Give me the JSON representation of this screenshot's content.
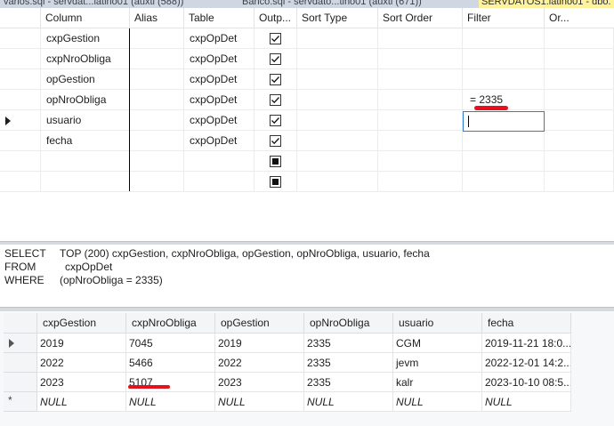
{
  "tabs": [
    {
      "label": "varios.sql - servdat...latino01 (auxti (588))"
    },
    {
      "label": "Banco.sql - servdato...tino01 (auxti (671))"
    },
    {
      "label": "SERVDATOS1.latino01 - dbo."
    }
  ],
  "criteria": {
    "headers": [
      "Column",
      "Alias",
      "Table",
      "Outp...",
      "Sort Type",
      "Sort Order",
      "Filter",
      "Or..."
    ],
    "rows": [
      {
        "column": "cxpGestion",
        "alias": "",
        "table": "cxpOpDet",
        "output": "checked",
        "filter": ""
      },
      {
        "column": "cxpNroObliga",
        "alias": "",
        "table": "cxpOpDet",
        "output": "checked",
        "filter": ""
      },
      {
        "column": "opGestion",
        "alias": "",
        "table": "cxpOpDet",
        "output": "checked",
        "filter": ""
      },
      {
        "column": "opNroObliga",
        "alias": "",
        "table": "cxpOpDet",
        "output": "checked",
        "filter": "= 2335"
      },
      {
        "column": "usuario",
        "alias": "",
        "table": "cxpOpDet",
        "output": "checked",
        "filter": ""
      },
      {
        "column": "fecha",
        "alias": "",
        "table": "cxpOpDet",
        "output": "checked",
        "filter": ""
      },
      {
        "column": "",
        "alias": "",
        "table": "",
        "output": "indeterminate",
        "filter": ""
      },
      {
        "column": "",
        "alias": "",
        "table": "",
        "output": "indeterminate",
        "filter": ""
      }
    ],
    "current_row": 4
  },
  "sql": {
    "select_kw": "SELECT",
    "select_clause": "TOP (200) cxpGestion, cxpNroObliga, opGestion, opNroObliga, usuario, fecha",
    "from_kw": "FROM",
    "from_clause": "cxpOpDet",
    "where_kw": "WHERE",
    "where_clause": "(opNroObliga = 2335)"
  },
  "results": {
    "headers": [
      "cxpGestion",
      "cxpNroObliga",
      "opGestion",
      "opNroObliga",
      "usuario",
      "fecha"
    ],
    "rows": [
      [
        "2019",
        "7045",
        "2019",
        "2335",
        "CGM",
        "2019-11-21 18:0..."
      ],
      [
        "2022",
        "5466",
        "2022",
        "2335",
        "jevm",
        "2022-12-01 14:2..."
      ],
      [
        "2023",
        "5107",
        "2023",
        "2335",
        "kalr",
        "2023-10-10 08:5..."
      ],
      [
        "NULL",
        "NULL",
        "NULL",
        "NULL",
        "NULL",
        "NULL"
      ]
    ],
    "new_row_marker": "*"
  },
  "colors": {
    "annotation_red": "#e8101e",
    "focus_border": "#2f7bd1",
    "active_tab": "#fff29d"
  }
}
